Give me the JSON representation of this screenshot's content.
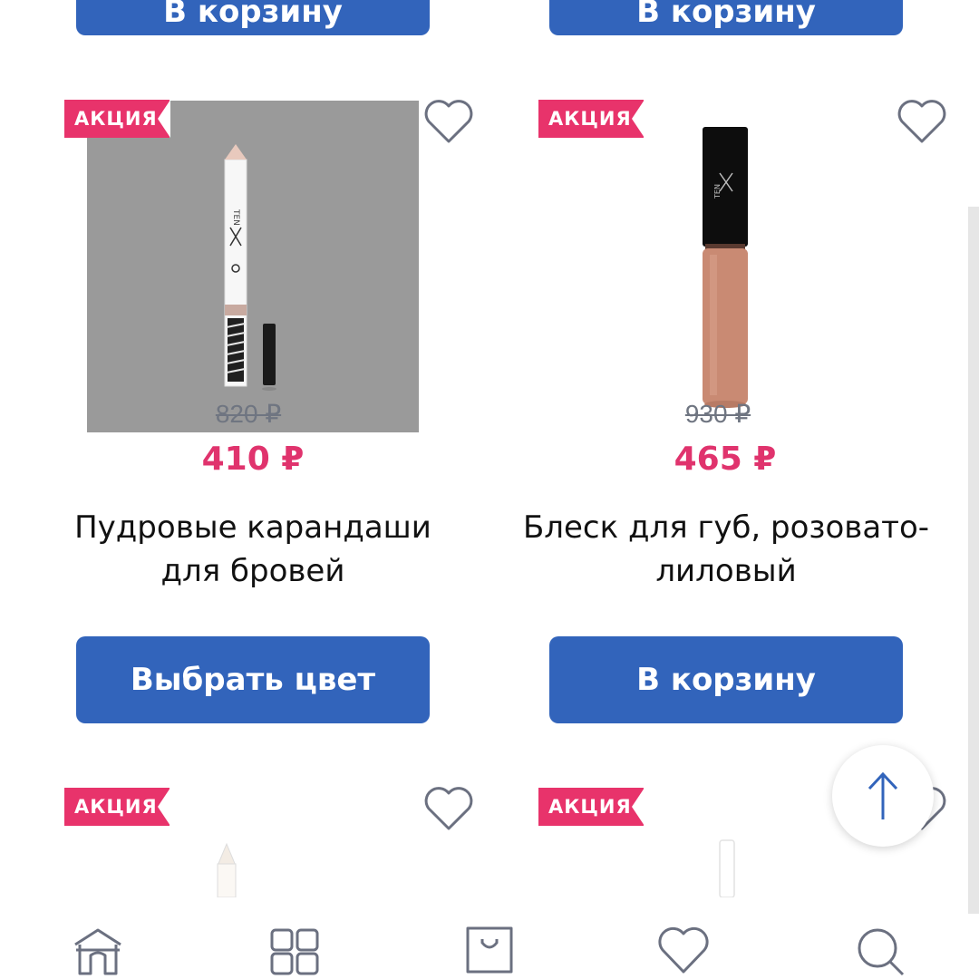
{
  "top_row": {
    "left_button_label": "В корзину",
    "right_button_label": "В корзину"
  },
  "products": [
    {
      "badge": "АКЦИЯ",
      "old_price": "820 ₽",
      "price": "410 ₽",
      "title_line1": "Пудровые карандаши",
      "title_line2": "для бровей",
      "button_label": "Выбрать цвет",
      "favorite": false
    },
    {
      "badge": "АКЦИЯ",
      "old_price": "930 ₽",
      "price": "465 ₽",
      "title_line1": "Блеск для губ, розовато-",
      "title_line2": "лиловый",
      "button_label": "В корзину",
      "favorite": false
    },
    {
      "badge": "АКЦИЯ",
      "favorite": false
    },
    {
      "badge": "АКЦИЯ",
      "favorite": false
    }
  ],
  "bottom_nav": {
    "items": [
      {
        "icon": "home-icon"
      },
      {
        "icon": "catalog-grid-icon"
      },
      {
        "icon": "cart-bag-icon"
      },
      {
        "icon": "favorites-heart-icon"
      },
      {
        "icon": "search-icon"
      }
    ]
  },
  "colors": {
    "accent_button": "#3264bb",
    "badge": "#e8336b",
    "price": "#e0336d",
    "old_price": "#6f7581",
    "icon_stroke": "#6b7080"
  }
}
